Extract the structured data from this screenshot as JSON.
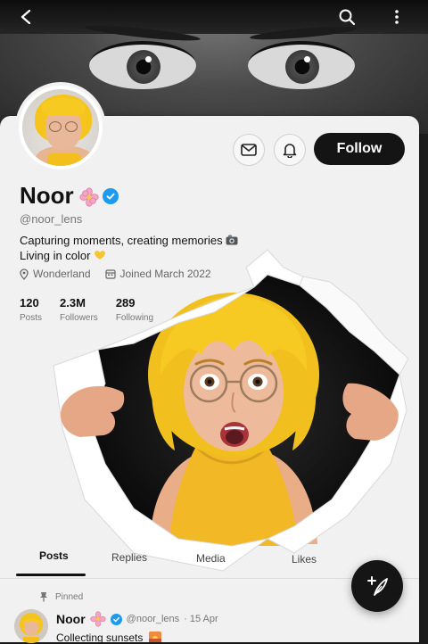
{
  "header": {
    "back_icon": "arrow-back-icon",
    "search_icon": "search-icon",
    "menu_icon": "more-vertical-icon"
  },
  "profile": {
    "name": "Noor",
    "handle": "@noor_lens",
    "bio_line1": "Capturing moments, creating memories",
    "bio_line2": "Living in color",
    "location": "Wonderland",
    "joined": "Joined March 2022",
    "stats": [
      {
        "value": "120",
        "label": "Posts"
      },
      {
        "value": "2.3M",
        "label": "Followers"
      },
      {
        "value": "289",
        "label": "Following"
      }
    ]
  },
  "actions": {
    "follow_label": "Follow",
    "message_icon": "mail-icon",
    "notify_icon": "bell-icon"
  },
  "tabs": [
    {
      "label": "Posts",
      "active": true
    },
    {
      "label": "Replies",
      "active": false
    },
    {
      "label": "Media",
      "active": false
    },
    {
      "label": "Likes",
      "active": false
    }
  ],
  "pinned_post": {
    "pinned_label": "Pinned",
    "author": "Noor",
    "handle": "@noor_lens",
    "date": "· 15 Apr",
    "text": "Collecting sunsets"
  },
  "colors": {
    "accent": "#141414",
    "verified": "#1d9bf0",
    "hair": "#f5c41d"
  }
}
